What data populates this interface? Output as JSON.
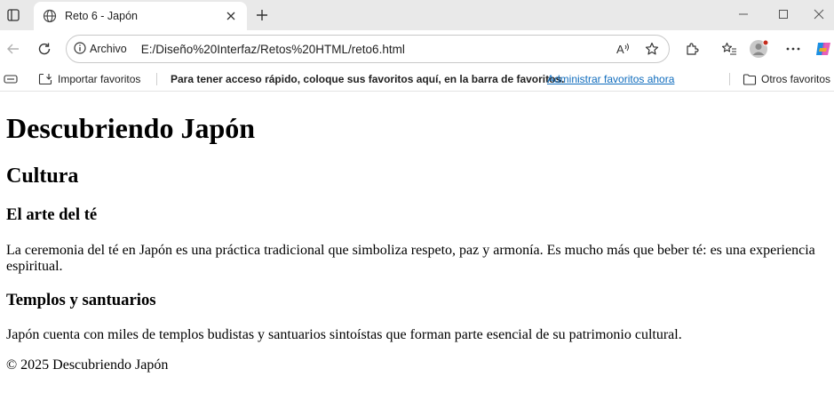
{
  "browser": {
    "tab": {
      "title": "Reto 6 - Japón"
    },
    "address": {
      "site_label": "Archivo",
      "url": "E:/Diseño%20Interfaz/Retos%20HTML/reto6.html"
    },
    "favorites_bar": {
      "import_label": "Importar favoritos",
      "message": "Para tener acceso rápido, coloque sus favoritos aquí, en la barra de favoritos.",
      "manage_link": "Administrar favoritos ahora",
      "other_label": "Otros favoritos"
    },
    "colors": {
      "tabstrip": "#e9e9e9",
      "link": "#0f6cbd",
      "profile_dot": "#c42b1c"
    }
  },
  "page": {
    "title": "Descubriendo Japón",
    "section_title": "Cultura",
    "subsections": [
      {
        "title": "El arte del té",
        "text": "La ceremonia del té en Japón es una práctica tradicional que simboliza respeto, paz y armonía. Es mucho más que beber té: es una experiencia espiritual."
      },
      {
        "title": "Templos y santuarios",
        "text": "Japón cuenta con miles de templos budistas y santuarios sintoístas que forman parte esencial de su patrimonio cultural."
      }
    ],
    "footer": "© 2025 Descubriendo Japón"
  }
}
